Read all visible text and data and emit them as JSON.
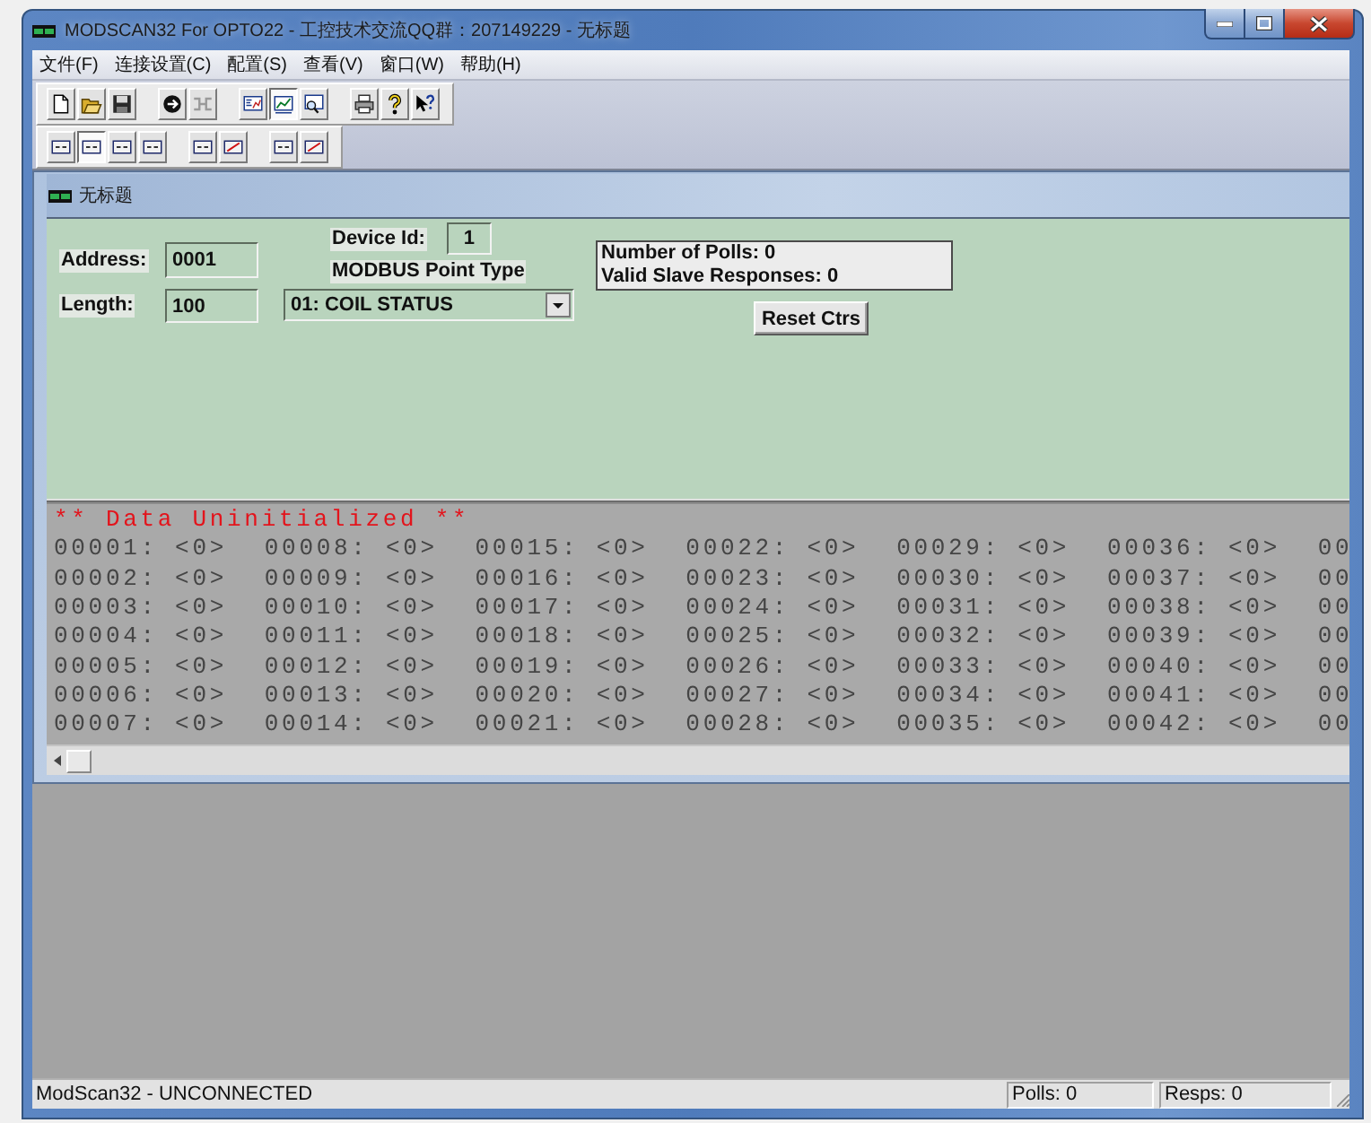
{
  "window": {
    "title": "MODSCAN32 For OPTO22 - 工控技术交流QQ群：207149229 - 无标题"
  },
  "menu": [
    "文件(F)",
    "连接设置(C)",
    "配置(S)",
    "查看(V)",
    "窗口(W)",
    "帮助(H)"
  ],
  "toolbar_1": [
    [
      {
        "kind": "new",
        "selected": false,
        "disabled": false
      },
      {
        "kind": "open",
        "selected": false,
        "disabled": false
      },
      {
        "kind": "save",
        "selected": false,
        "disabled": false
      }
    ],
    [
      {
        "kind": "connect",
        "selected": false,
        "disabled": false
      },
      {
        "kind": "disconnect",
        "selected": false,
        "disabled": true
      }
    ],
    [
      {
        "kind": "display_graph",
        "selected": false,
        "disabled": false
      },
      {
        "kind": "display_chart",
        "selected": true,
        "disabled": false
      },
      {
        "kind": "display_zoom",
        "selected": false,
        "disabled": false
      }
    ],
    [
      {
        "kind": "print",
        "selected": false,
        "disabled": false
      },
      {
        "kind": "help",
        "selected": false,
        "disabled": false
      },
      {
        "kind": "context_help",
        "selected": false,
        "disabled": false
      }
    ]
  ],
  "toolbar_2": [
    [
      {
        "kind": "frame",
        "selected": false,
        "disabled": false
      },
      {
        "kind": "frame",
        "selected": true,
        "disabled": false
      },
      {
        "kind": "frame",
        "selected": false,
        "disabled": false
      },
      {
        "kind": "frame",
        "selected": false,
        "disabled": false
      }
    ],
    [
      {
        "kind": "frame",
        "selected": false,
        "disabled": false
      },
      {
        "kind": "frame_slash",
        "selected": false,
        "disabled": false
      }
    ],
    [
      {
        "kind": "frame",
        "selected": false,
        "disabled": false
      },
      {
        "kind": "frame_slash",
        "selected": false,
        "disabled": false
      }
    ]
  ],
  "document": {
    "title": "无标题",
    "form": {
      "address_label": "Address:",
      "address": "0001",
      "length_label": "Length:",
      "length": "100",
      "device_id_label": "Device Id:",
      "device_id": "1",
      "point_type_label": "MODBUS Point Type",
      "point_type": "01: COIL STATUS",
      "polls": "Number of Polls: 0",
      "responses": "Valid Slave Responses: 0",
      "reset_button": "Reset Ctrs"
    },
    "data": {
      "status": "** Data Uninitialized **",
      "rows": [
        [
          "00001: <0>",
          "00008: <0>",
          "00015: <0>",
          "00022: <0>",
          "00029: <0>",
          "00036: <0>",
          "00"
        ],
        [
          "00002: <0>",
          "00009: <0>",
          "00016: <0>",
          "00023: <0>",
          "00030: <0>",
          "00037: <0>",
          "00"
        ],
        [
          "00003: <0>",
          "00010: <0>",
          "00017: <0>",
          "00024: <0>",
          "00031: <0>",
          "00038: <0>",
          "00"
        ],
        [
          "00004: <0>",
          "00011: <0>",
          "00018: <0>",
          "00025: <0>",
          "00032: <0>",
          "00039: <0>",
          "00"
        ],
        [
          "00005: <0>",
          "00012: <0>",
          "00019: <0>",
          "00026: <0>",
          "00033: <0>",
          "00040: <0>",
          "00"
        ],
        [
          "00006: <0>",
          "00013: <0>",
          "00020: <0>",
          "00027: <0>",
          "00034: <0>",
          "00041: <0>",
          "00"
        ],
        [
          "00007: <0>",
          "00014: <0>",
          "00021: <0>",
          "00028: <0>",
          "00035: <0>",
          "00042: <0>",
          "00"
        ]
      ]
    }
  },
  "status_bar": {
    "text": "ModScan32 - UNCONNECTED",
    "polls": "Polls: 0",
    "resps": "Resps: 0"
  }
}
